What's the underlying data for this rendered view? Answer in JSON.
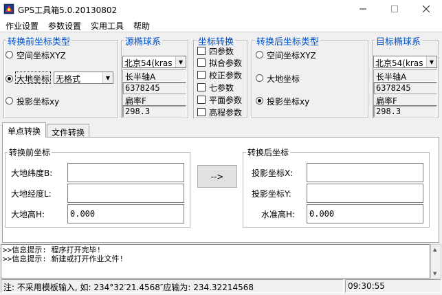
{
  "window": {
    "title": "GPS工具箱5.0.20130802"
  },
  "menu": [
    "作业设置",
    "参数设置",
    "实用工具",
    "帮助"
  ],
  "source_coord_type": {
    "title": "转换前坐标类型",
    "options": [
      "空间坐标XYZ",
      "大地坐标",
      "投影坐标xy"
    ],
    "selected": 1,
    "format_value": "无格式"
  },
  "source_ellipsoid": {
    "title": "源椭球系",
    "value": "北京54(kras",
    "semi_major_label": "长半轴A",
    "semi_major_value": "6378245",
    "flattening_label": "扁率F",
    "flattening_value": "298.3"
  },
  "coord_transform": {
    "title": "坐标转换",
    "options": [
      "四参数",
      "拟合参数",
      "校正参数",
      "七参数",
      "平面参数",
      "高程参数"
    ]
  },
  "target_coord_type": {
    "title": "转换后坐标类型",
    "options": [
      "空间坐标XYZ",
      "大地坐标",
      "投影坐标xy"
    ],
    "selected": 2
  },
  "target_ellipsoid": {
    "title": "目标椭球系",
    "value": "北京54(kras",
    "semi_major_label": "长半轴A",
    "semi_major_value": "6378245",
    "flattening_label": "扁率F",
    "flattening_value": "298.3"
  },
  "tabs": [
    "单点转换",
    "文件转换"
  ],
  "before": {
    "title": "转换前坐标",
    "fields": [
      {
        "label": "大地纬度B:",
        "value": ""
      },
      {
        "label": "大地经度L:",
        "value": ""
      },
      {
        "label": "大地高H:",
        "value": "0.000"
      }
    ]
  },
  "convert_button": "-->",
  "after": {
    "title": "转换后坐标",
    "fields": [
      {
        "label": "投影坐标X:",
        "value": ""
      },
      {
        "label": "投影坐标Y:",
        "value": ""
      },
      {
        "label": "水准高H:",
        "value": "0.000"
      }
    ]
  },
  "log": [
    ">>信息提示: 程序打开完毕!",
    ">>信息提示: 新建或打开作业文件!"
  ],
  "status": {
    "hint": "注: 不采用模板输入, 如: 234°32′21.4568″应输为: 234.32214568",
    "time": "09:30:55"
  }
}
